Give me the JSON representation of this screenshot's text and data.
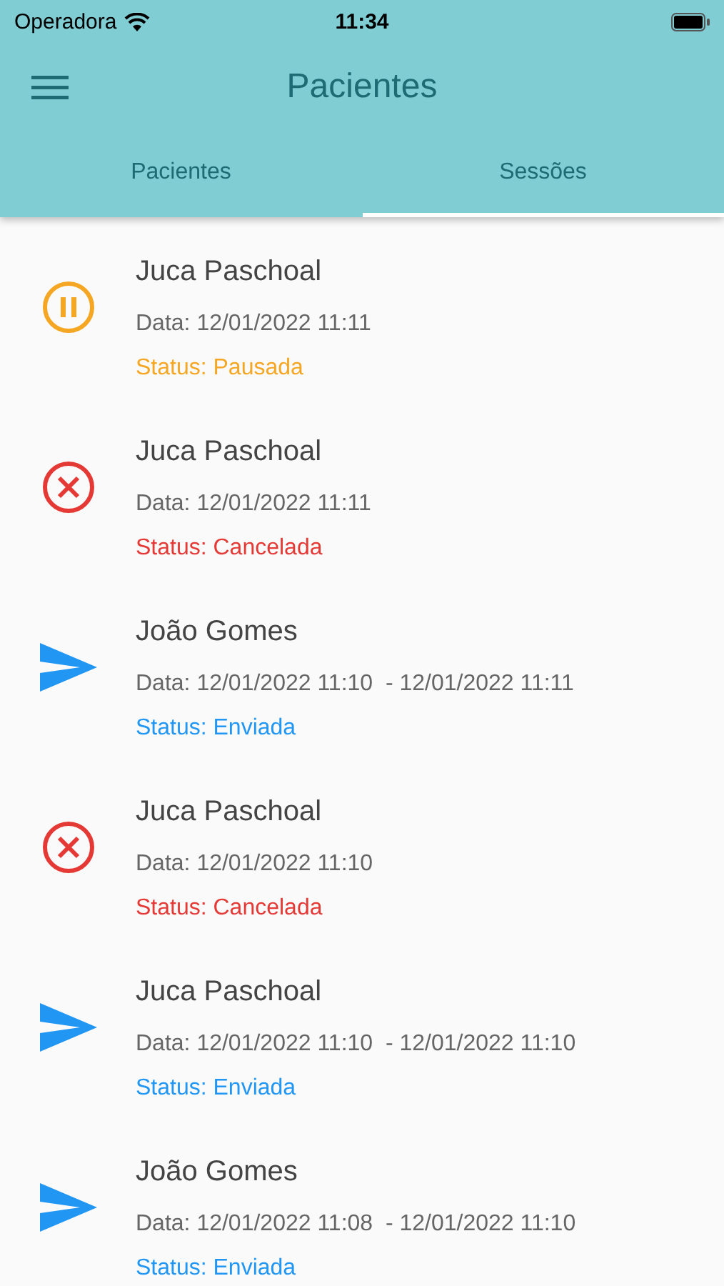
{
  "status_bar": {
    "carrier": "Operadora",
    "time": "11:34"
  },
  "app_bar": {
    "title": "Pacientes"
  },
  "tabs": [
    {
      "label": "Pacientes",
      "selected": false
    },
    {
      "label": "Sessões",
      "selected": true
    }
  ],
  "sessions": [
    {
      "kind": "paused",
      "name": "Juca Paschoal",
      "date": "Data: 12/01/2022 11:11",
      "status": "Status: Pausada"
    },
    {
      "kind": "cancelled",
      "name": "Juca Paschoal",
      "date": "Data: 12/01/2022 11:11",
      "status": "Status: Cancelada"
    },
    {
      "kind": "sent",
      "name": "João Gomes",
      "date": "Data: 12/01/2022 11:10  - 12/01/2022 11:11",
      "status": "Status: Enviada"
    },
    {
      "kind": "cancelled",
      "name": "Juca Paschoal",
      "date": "Data: 12/01/2022 11:10",
      "status": "Status: Cancelada"
    },
    {
      "kind": "sent",
      "name": "Juca Paschoal",
      "date": "Data: 12/01/2022 11:10  - 12/01/2022 11:10",
      "status": "Status: Enviada"
    },
    {
      "kind": "sent",
      "name": "João Gomes",
      "date": "Data: 12/01/2022 11:08  - 12/01/2022 11:10",
      "status": "Status: Enviada"
    }
  ]
}
